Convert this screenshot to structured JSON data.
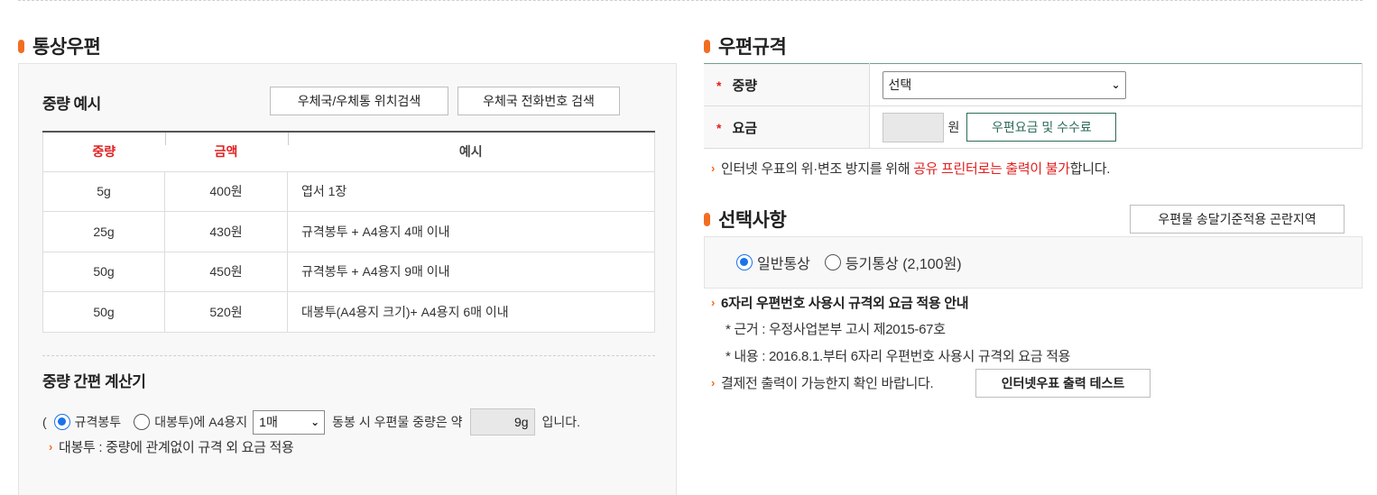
{
  "left": {
    "title": "통상우편",
    "weight_examples": {
      "title": "중량 예시",
      "btn_location": "우체국/우체통 위치검색",
      "btn_phone": "우체국 전화번호 검색",
      "headers": [
        "중량",
        "금액",
        "예시"
      ],
      "rows": [
        [
          "5g",
          "400원",
          "엽서 1장"
        ],
        [
          "25g",
          "430원",
          "규격봉투 + A4용지 4매 이내"
        ],
        [
          "50g",
          "450원",
          "규격봉투 + A4용지 9매 이내"
        ],
        [
          "50g",
          "520원",
          "대봉투(A4용지 크기)+ A4용지 6매 이내"
        ]
      ]
    },
    "calculator": {
      "title": "중량 간편 계산기",
      "open_paren": "(",
      "opt_standard": "규격봉투",
      "opt_large": "대봉투",
      "text_a4": ")에 A4용지",
      "sheets_selected": "1매",
      "text_mid": "동봉 시 우편물 중량은 약",
      "result": "9g",
      "text_end": "입니다.",
      "note": "대봉투 : 중량에 관계없이 규격 외 요금 적용"
    }
  },
  "right": {
    "spec_title": "우편규격",
    "weight_label": "중량",
    "weight_selected": "선택",
    "fee_label": "요금",
    "fee_unit": "원",
    "fee_btn": "우편요금 및 수수료",
    "notice_prefix": "인터넷 우표의 위·변조 방지를 위해 ",
    "notice_red": "공유 프린터로는 출력이 불가",
    "notice_suffix": "합니다.",
    "options_title": "선택사항",
    "region_btn": "우편물 송달기준적용 곤란지역",
    "opt_normal": "일반통상",
    "opt_registered": "등기통상 (2,100원)",
    "info_title": "6자리 우편번호 사용시 규격외 요금 적용 안내",
    "info_basis": "* 근거 : 우정사업본부 고시 제2015-67호",
    "info_content": "* 내용 : 2016.8.1.부터 6자리 우편번호 사용시 규격외 요금 적용",
    "print_notice": "결제전 출력이 가능한지 확인 바랍니다.",
    "print_test_btn": "인터넷우표 출력 테스트"
  },
  "colors": {
    "accent": "#f26d22",
    "red": "#e02020",
    "radio_blue": "#1a73e8",
    "spec_border": "#6fa08a"
  }
}
